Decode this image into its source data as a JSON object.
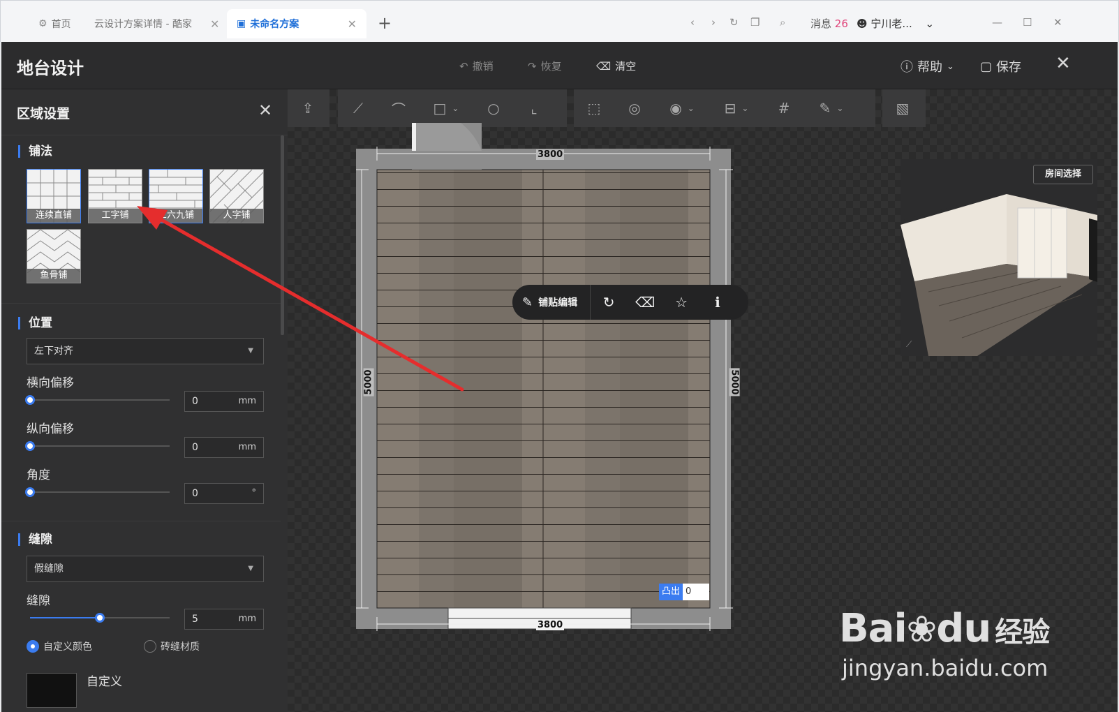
{
  "browser": {
    "tabs": [
      {
        "label": "首页",
        "active": false
      },
      {
        "label": "云设计方案详情 - 酷家",
        "active": false
      },
      {
        "label": "未命名方案",
        "active": true
      }
    ],
    "new_tab": "+",
    "messages_label": "消息",
    "messages_count": "26",
    "user_name": "宁川老..."
  },
  "app": {
    "title": "地台设计",
    "actions": {
      "undo": "撤销",
      "redo": "恢复",
      "clear": "清空"
    },
    "help": "帮助",
    "save": "保存"
  },
  "panel": {
    "title": "区域设置",
    "paving": {
      "heading": "铺法",
      "options": [
        "连续直铺",
        "工字铺",
        "三六九铺",
        "人字铺",
        "鱼骨铺"
      ]
    },
    "position": {
      "heading": "位置",
      "align_value": "左下对齐",
      "h_offset_label": "横向偏移",
      "h_offset_value": "0",
      "v_offset_label": "纵向偏移",
      "v_offset_value": "0",
      "angle_label": "角度",
      "angle_value": "0",
      "unit_mm": "mm",
      "unit_deg": "°"
    },
    "gap": {
      "heading": "缝隙",
      "type_value": "假缝隙",
      "gap_label": "缝隙",
      "gap_value": "5",
      "gap_fraction": 0.5,
      "radio_custom": "自定义颜色",
      "radio_material": "砖缝材质",
      "custom_label": "自定义"
    }
  },
  "canvas": {
    "dim_top": "3800",
    "dim_bottom": "3800",
    "dim_left": "5000",
    "dim_right": "5000",
    "float_edit": "铺贴编辑",
    "protrude_label": "凸出",
    "protrude_value": "0",
    "room_select": "房间选择"
  },
  "watermark": {
    "brand": "Bai",
    "brand2": "du",
    "cn": "经验",
    "url": "jingyan.baidu.com"
  },
  "colors": {
    "accent": "#3b7cf0",
    "arrow": "#e52d2d",
    "tab_active": "#1f6fd8",
    "badge": "#e0457b"
  }
}
